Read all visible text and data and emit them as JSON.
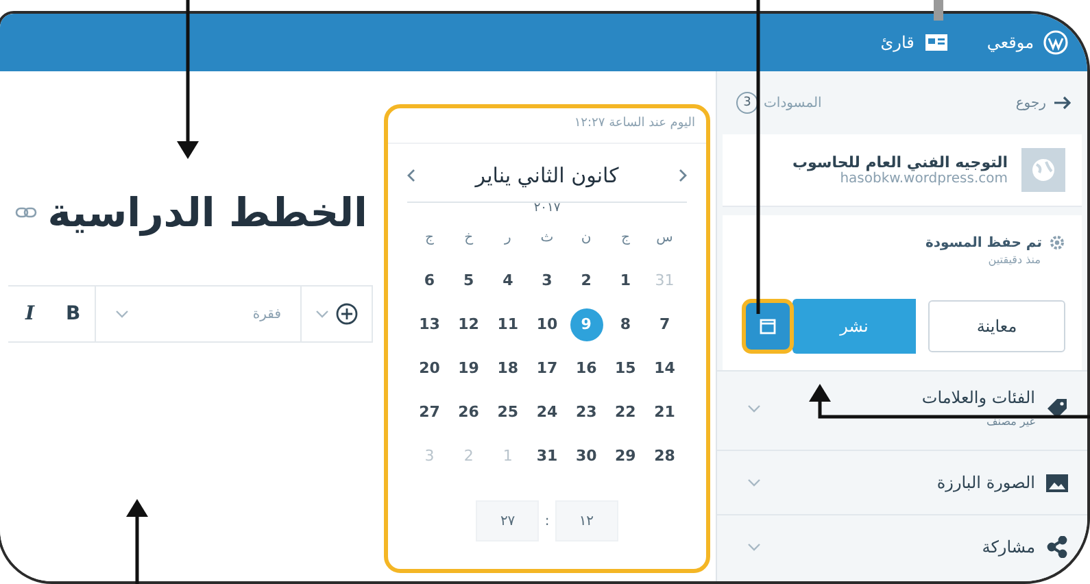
{
  "top_bar": {
    "items": [
      {
        "kind": "site",
        "label": "موقعي"
      },
      {
        "kind": "reader",
        "label": "قارئ"
      }
    ]
  },
  "sidebar": {
    "back": "رجوع",
    "drafts": {
      "label": "المسودات",
      "count": "3"
    },
    "site": {
      "name": "التوجيه الفني العام للحاسوب",
      "url": "hasobkw.wordpress.com"
    },
    "status": {
      "title": "تم حفظ المسودة",
      "subtitle": "منذ دقيقتين"
    },
    "preview_button": "معاينة",
    "publish_button": "نشر",
    "sections": [
      {
        "kind": "tags",
        "label": "الفئات والعلامات",
        "subtitle": "غير مصنف"
      },
      {
        "kind": "image",
        "label": "الصورة البارزة"
      },
      {
        "kind": "share",
        "label": "مشاركة"
      }
    ]
  },
  "editor": {
    "title": "الخطط الدراسية",
    "block_type": "فقرة",
    "format_buttons": [
      {
        "kind": "bold",
        "label": "B"
      },
      {
        "kind": "italic",
        "label": "I"
      }
    ]
  },
  "calendar": {
    "caption": "اليوم عند الساعة ١٢:٢٧",
    "month": "كانون الثاني يناير",
    "year": "٢٠١٧",
    "weekdays": [
      "س",
      "ج",
      "ن",
      "ث",
      "ر",
      "خ",
      "ج"
    ],
    "weeks": [
      {
        "days": [
          {
            "day": "31",
            "in_month": false,
            "selected": false
          },
          {
            "day": "1",
            "in_month": true,
            "selected": false
          },
          {
            "day": "2",
            "in_month": true,
            "selected": false
          },
          {
            "day": "3",
            "in_month": true,
            "selected": false
          },
          {
            "day": "4",
            "in_month": true,
            "selected": false
          },
          {
            "day": "5",
            "in_month": true,
            "selected": false
          },
          {
            "day": "6",
            "in_month": true,
            "selected": false
          }
        ]
      },
      {
        "days": [
          {
            "day": "7",
            "in_month": true,
            "selected": false
          },
          {
            "day": "8",
            "in_month": true,
            "selected": false
          },
          {
            "day": "9",
            "in_month": true,
            "selected": true
          },
          {
            "day": "10",
            "in_month": true,
            "selected": false
          },
          {
            "day": "11",
            "in_month": true,
            "selected": false
          },
          {
            "day": "12",
            "in_month": true,
            "selected": false
          },
          {
            "day": "13",
            "in_month": true,
            "selected": false
          }
        ]
      },
      {
        "days": [
          {
            "day": "14",
            "in_month": true,
            "selected": false
          },
          {
            "day": "15",
            "in_month": true,
            "selected": false
          },
          {
            "day": "16",
            "in_month": true,
            "selected": false
          },
          {
            "day": "17",
            "in_month": true,
            "selected": false
          },
          {
            "day": "18",
            "in_month": true,
            "selected": false
          },
          {
            "day": "19",
            "in_month": true,
            "selected": false
          },
          {
            "day": "20",
            "in_month": true,
            "selected": false
          }
        ]
      },
      {
        "days": [
          {
            "day": "21",
            "in_month": true,
            "selected": false
          },
          {
            "day": "22",
            "in_month": true,
            "selected": false
          },
          {
            "day": "23",
            "in_month": true,
            "selected": false
          },
          {
            "day": "24",
            "in_month": true,
            "selected": false
          },
          {
            "day": "25",
            "in_month": true,
            "selected": false
          },
          {
            "day": "26",
            "in_month": true,
            "selected": false
          },
          {
            "day": "27",
            "in_month": true,
            "selected": false
          }
        ]
      },
      {
        "days": [
          {
            "day": "28",
            "in_month": true,
            "selected": false
          },
          {
            "day": "29",
            "in_month": true,
            "selected": false
          },
          {
            "day": "30",
            "in_month": true,
            "selected": false
          },
          {
            "day": "31",
            "in_month": true,
            "selected": false
          },
          {
            "day": "1",
            "in_month": false,
            "selected": false
          },
          {
            "day": "2",
            "in_month": false,
            "selected": false
          },
          {
            "day": "3",
            "in_month": false,
            "selected": false
          }
        ]
      }
    ],
    "time": {
      "hour": "١٢",
      "separator": ":",
      "minute": "٢٧"
    }
  }
}
